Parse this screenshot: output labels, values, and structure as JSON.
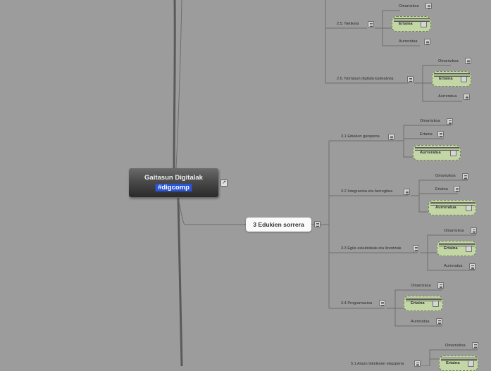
{
  "root": {
    "title": "Gaitasun Digitalak",
    "tag": "#digcomp",
    "link_icon": "link-icon"
  },
  "branch": {
    "label": "3 Edukien sorrera"
  },
  "subtopics": {
    "s25": "2.5. Netiketa",
    "s26": "2.6. Nortasun digitala kudeatzea.",
    "s31": "3.1 Edukien garapena",
    "s32": "3.2 Integrazioa eta berregitea",
    "s33": "3.3 Egile eskubideak eta lizentziak",
    "s34": "3.4 Programazioa",
    "s51": "5.1 Arazo teknikoen ebazpena"
  },
  "levels": {
    "basic": "Oinarrizkoa",
    "mid": "Ertaina",
    "adv": "Aurreratua"
  },
  "colors": {
    "background": "#9c9c9c",
    "pill": "#c3d6a5",
    "tag": "#2a55d6"
  }
}
